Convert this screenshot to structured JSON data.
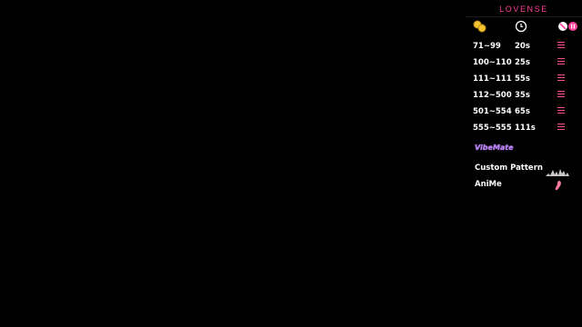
{
  "brand": "LOVENSE",
  "header_icons": [
    "coins-icon",
    "clock-icon",
    "pattern-icon",
    "pause-icon"
  ],
  "colors": {
    "accent": "#ff3f9a",
    "pattern": "#ff4f8a",
    "vibemate": "#b97cff",
    "coin": "#f4c430"
  },
  "rows": [
    {
      "range": "71~99",
      "duration": "20s"
    },
    {
      "range": "100~110",
      "duration": "25s"
    },
    {
      "range": "111~111",
      "duration": "55s"
    },
    {
      "range": "112~500",
      "duration": "35s"
    },
    {
      "range": "501~554",
      "duration": "65s"
    },
    {
      "range": "555~555",
      "duration": "111s"
    }
  ],
  "vibemate_label": "VibeMate",
  "extras": [
    {
      "label": "Custom Pattern",
      "icon": "waveform-icon"
    },
    {
      "label": "AniMe",
      "icon": "pink-toy-icon"
    }
  ]
}
